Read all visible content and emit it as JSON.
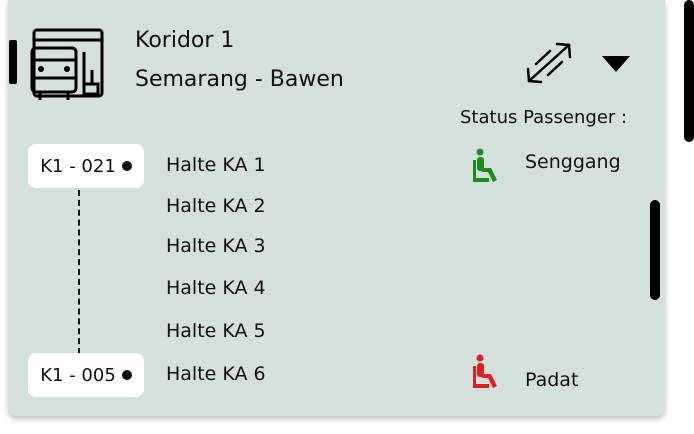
{
  "header": {
    "corridor": "Koridor 1",
    "route": "Semarang - Bawen"
  },
  "status": {
    "title": "Status Passenger :"
  },
  "buses": [
    {
      "id": "K1 - 021",
      "status": "Senggang",
      "status_color": "#1a8c1a"
    },
    {
      "id": "K1 - 005",
      "status": "Padat",
      "status_color": "#e02020"
    }
  ],
  "stops": [
    "Halte KA 1",
    "Halte KA 2",
    "Halte KA 3",
    "Halte KA 4",
    "Halte KA 5",
    "Halte KA 6"
  ],
  "icons": {
    "bus": "bus-icon",
    "expand": "expand-arrows-icon",
    "dropdown": "caret-down-icon",
    "passenger": "seated-passenger-icon"
  },
  "colors": {
    "card_bg": "#d4e0dc",
    "senggang": "#1a8c1a",
    "padat": "#e02020"
  }
}
